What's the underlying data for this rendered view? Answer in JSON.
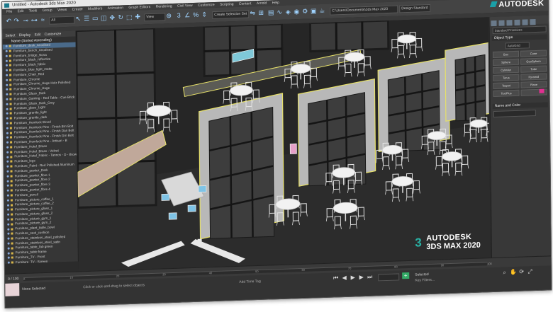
{
  "window": {
    "title": "Untitled - Autodesk 3ds Max 2020",
    "controls": [
      "—",
      "□",
      "✕"
    ]
  },
  "menubar": [
    "File",
    "Edit",
    "Tools",
    "Group",
    "Views",
    "Create",
    "Modifiers",
    "Animation",
    "Graph Editors",
    "Rendering",
    "Civil View",
    "Customize",
    "Scripting",
    "Content",
    "Arnold",
    "Help"
  ],
  "toolbar": {
    "selection_set": "Create Selection Set",
    "workspace": "Design Standard",
    "view": "View",
    "path": "C:\\Users\\Documents\\3ds Max 2020"
  },
  "brand": {
    "top": "AUTODESK",
    "viewport_line1": "AUTODESK",
    "viewport_line2": "3DS MAX 2020"
  },
  "explorer": {
    "tabs": [
      "Select",
      "Display",
      "Edit",
      "Customize"
    ],
    "header": "Name (Sorted Ascending)",
    "items": [
      "Furniture_desk_Anodised",
      "Furniture_bench_Anodised",
      "Furniture_bridge_Nova",
      "Furniture_black_reflective",
      "Furniture_black_fabric",
      "Furniture_blue_light_matte",
      "Furniture_Chair_Red",
      "Furniture_Chrome",
      "Furniture_Chrome_Huge Holz Polished",
      "Furniture_Chrome_Huge",
      "Furniture_Glass_Dark",
      "Furniture_Gaming - Red Table - Cue Brick",
      "Furniture_Glass_Dark_Grey",
      "Furniture_glass_Light",
      "Furniture_granite_light",
      "Furniture_granite_dark",
      "Furniture_Hemlock Wood",
      "Furniture_Hemlock Pine - Finish Brn Bolt",
      "Furniture_Hemlock Pine - Finish Dan Bolt",
      "Furniture_Hemlock Pine - Finish Grn Bolt",
      "Furniture_Hemlock Pine - Artisan - B",
      "Furniture_Hotel_Brass",
      "Furniture_Hotel_Brass - Velvet",
      "Furniture_Hotel_Fabric - Tannos - D - Brown",
      "Furniture_legs",
      "Furniture_Paint - Red Polished Aluminum",
      "Furniture_pewter_Dark",
      "Furniture_pewter_fibre 1",
      "Furniture_pewter_fibre 2",
      "Furniture_pewter_fibre 3",
      "Furniture_pewter_fibre 4",
      "Furniture_pencil",
      "Furniture_picture_coffee_1",
      "Furniture_picture_coffee_2",
      "Furniture_picture_glass_1",
      "Furniture_picture_glass_2",
      "Furniture_picture_gym_1",
      "Furniture_picture_gym_2",
      "Furniture_plant_table_bowl",
      "Furniture_seat_cushion",
      "Furniture_stainless_steel_polished",
      "Furniture_stainless_steel_satin",
      "Furniture_table_fab green",
      "Furniture_table frame",
      "Furniture_TV - Front",
      "Furniture_TV - Screen",
      "Furniture_white_matte"
    ]
  },
  "command_panel": {
    "category": "Standard Primitives",
    "object_type_label": "Object Type",
    "autogrid": "AutoGrid",
    "buttons": [
      "Box",
      "Cone",
      "Sphere",
      "GeoSphere",
      "Cylinder",
      "Tube",
      "Torus",
      "Pyramid",
      "Teapot",
      "Plane",
      "TextPlus",
      ""
    ],
    "name_color_label": "Name and Color",
    "swatch_color": "#e03090"
  },
  "timeline": {
    "frame_readout": "0 / 100",
    "ticks": [
      "0",
      "10",
      "20",
      "30",
      "40",
      "50",
      "60",
      "70",
      "80",
      "90",
      "100"
    ]
  },
  "statusbar": {
    "left": "None Selected",
    "right": "Click or click-and-drag to select objects",
    "add_time_tag": "Add Time Tag",
    "selected": "Selected",
    "set_key": "Set Key",
    "key_filters": "Key Filters..."
  },
  "colors": {
    "accent": "#29b3a6",
    "viewport_bg": "#262626",
    "selection": "#e6e06a",
    "wall": "#b8b8b8"
  }
}
